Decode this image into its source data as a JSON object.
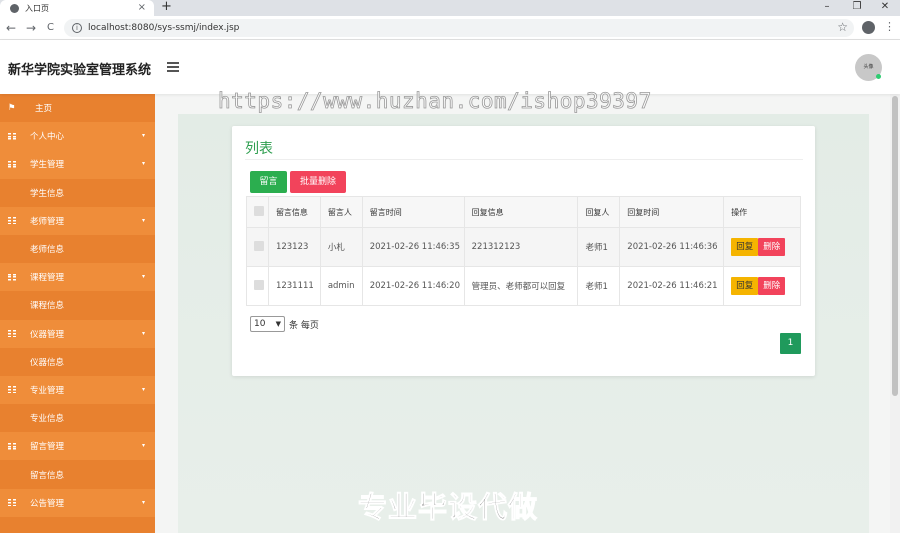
{
  "browser": {
    "tab_title": "入口页",
    "tab_close": "×",
    "new_tab": "+",
    "url": "localhost:8080/sys-ssmj/index.jsp",
    "win_minimize": "–",
    "win_restore": "❐",
    "win_close": "✕",
    "back": "←",
    "forward": "→",
    "reload": "C",
    "star": "☆",
    "menu": "⋮"
  },
  "header": {
    "title": "新华学院实验室管理系统",
    "avatar_text": "头像"
  },
  "watermark": "https://www.huzhan.com/ishop39397",
  "footer_watermark": "专业毕设代做",
  "sidebar": {
    "home": "主页",
    "items": [
      {
        "label": "个人中心",
        "type": "group"
      },
      {
        "label": "学生管理",
        "type": "group"
      },
      {
        "label": "学生信息",
        "type": "sub"
      },
      {
        "label": "老师管理",
        "type": "group"
      },
      {
        "label": "老师信息",
        "type": "sub"
      },
      {
        "label": "课程管理",
        "type": "group"
      },
      {
        "label": "课程信息",
        "type": "sub"
      },
      {
        "label": "仪器管理",
        "type": "group"
      },
      {
        "label": "仪器信息",
        "type": "sub"
      },
      {
        "label": "专业管理",
        "type": "group"
      },
      {
        "label": "专业信息",
        "type": "sub"
      },
      {
        "label": "留言管理",
        "type": "group"
      },
      {
        "label": "留言信息",
        "type": "sub"
      },
      {
        "label": "公告管理",
        "type": "group"
      }
    ]
  },
  "card": {
    "title": "列表",
    "btn_message": "留言",
    "btn_batch_delete": "批量删除",
    "columns": [
      "留言信息",
      "留言人",
      "留言时间",
      "回复信息",
      "回复人",
      "回复时间",
      "操作"
    ],
    "rows": [
      {
        "message": "123123",
        "author": "小札",
        "time": "2021-02-26 11:46:35",
        "reply": "221312123",
        "replier": "老师1",
        "reply_time": "2021-02-26 11:46:36"
      },
      {
        "message": "1231111",
        "author": "admin",
        "time": "2021-02-26 11:46:20",
        "reply": "管理员、老师都可以回复",
        "replier": "老师1",
        "reply_time": "2021-02-26 11:46:21"
      }
    ],
    "op_reply": "回复",
    "op_delete": "删除",
    "page_size": "10",
    "page_size_suffix": "条 每页",
    "current_page": "1"
  },
  "colors": {
    "sidebar_bg": "#e8812f",
    "accent_green": "#2bae4f",
    "danger": "#f2435b",
    "warning": "#f5b400"
  }
}
